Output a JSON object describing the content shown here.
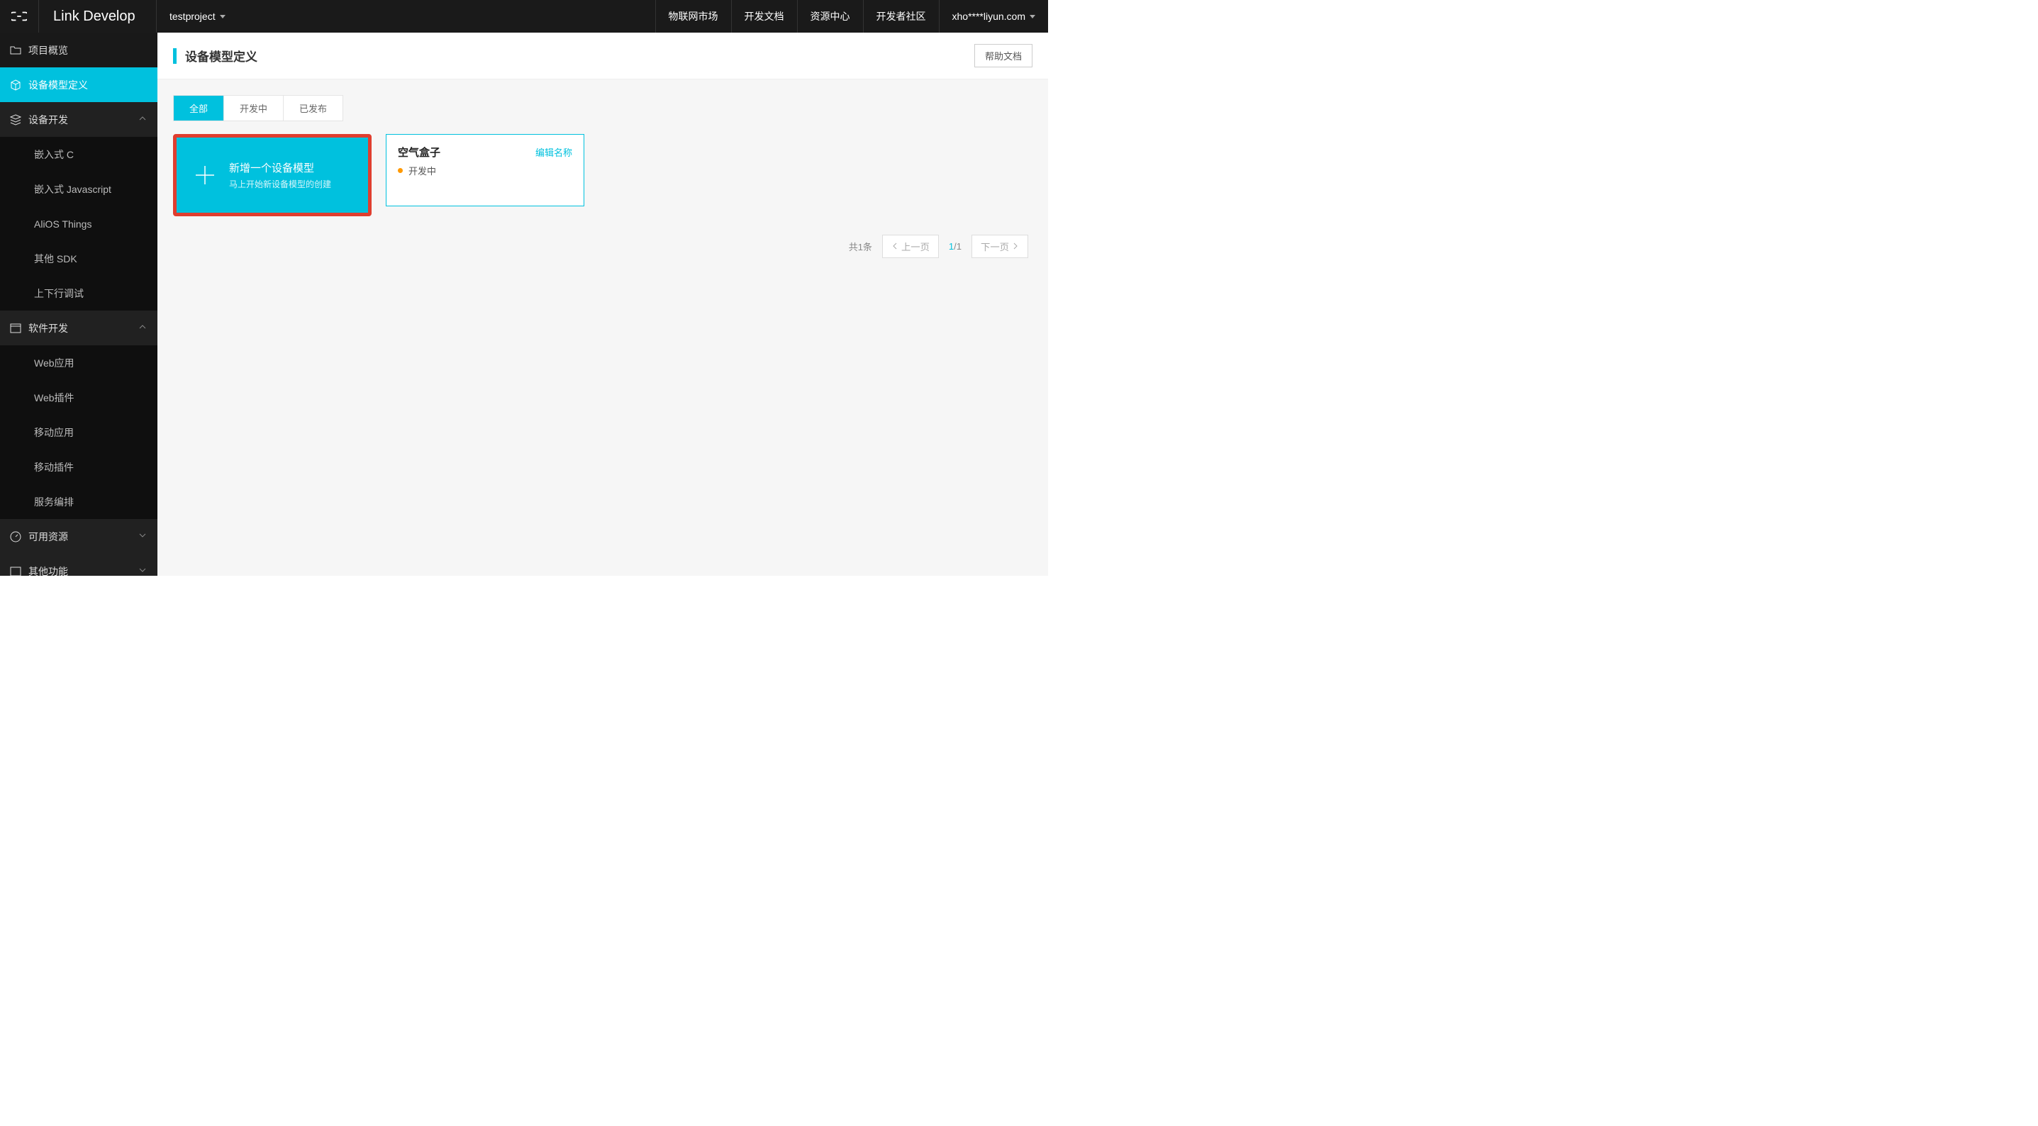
{
  "header": {
    "brand": "Link Develop",
    "project": "testproject",
    "nav": [
      "物联网市场",
      "开发文档",
      "资源中心",
      "开发者社区"
    ],
    "user": "xho****liyun.com"
  },
  "sidebar": {
    "overview": "项目概览",
    "model_def": "设备模型定义",
    "device_dev": {
      "label": "设备开发",
      "items": [
        "嵌入式 C",
        "嵌入式 Javascript",
        "AliOS Things",
        "其他 SDK",
        "上下行调试"
      ]
    },
    "software_dev": {
      "label": "软件开发",
      "items": [
        "Web应用",
        "Web插件",
        "移动应用",
        "移动插件",
        "服务编排"
      ]
    },
    "resources": "可用资源",
    "other": "其他功能"
  },
  "page": {
    "title": "设备模型定义",
    "help_button": "帮助文档"
  },
  "tabs": [
    "全部",
    "开发中",
    "已发布"
  ],
  "add_card": {
    "title": "新增一个设备模型",
    "subtitle": "马上开始新设备模型的创建"
  },
  "device_card": {
    "name": "空气盒子",
    "edit": "编辑名称",
    "status_label": "开发中",
    "status_color": "#ff9900"
  },
  "pagination": {
    "total_text": "共1条",
    "prev": "上一页",
    "next": "下一页",
    "current": "1",
    "total_pages": "1"
  }
}
